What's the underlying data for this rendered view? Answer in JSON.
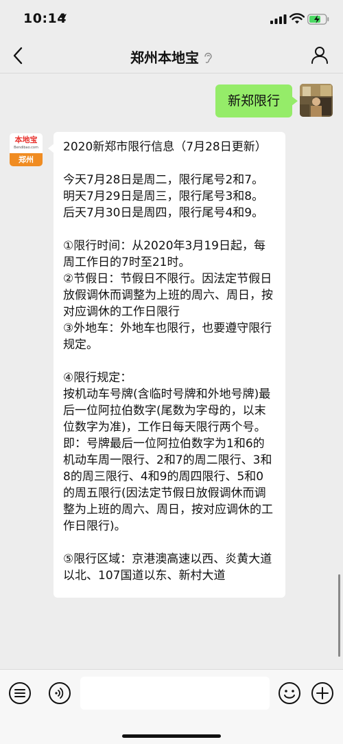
{
  "status_bar": {
    "time": "10:14"
  },
  "nav": {
    "title": "郑州本地宝"
  },
  "outgoing_message": {
    "text": "新郑限行"
  },
  "bot": {
    "logo_text": "本地宝",
    "logo_url": "Bendibao.com",
    "city_tag": "郑州"
  },
  "incoming_message": {
    "text": "2020新郑市限行信息（7月28日更新）\n\n今天7月28日是周二，限行尾号2和7。\n明天7月29日是周三，限行尾号3和8。\n后天7月30日是周四，限行尾号4和9。\n\n①限行时间：从2020年3月19日起，每周工作日的7时至21时。\n②节假日：节假日不限行。因法定节假日放假调休而调整为上班的周六、周日，按对应调休的工作日限行\n③外地车：外地车也限行，也要遵守限行规定。\n\n④限行规定：\n按机动车号牌(含临时号牌和外地号牌)最后一位阿拉伯数字(尾数为字母的，以末位数字为准)，工作日每天限行两个号。即：号牌最后一位阿拉伯数字为1和6的机动车周一限行、2和7的周二限行、3和8的周三限行、4和9的周四限行、5和0的周五限行(因法定节假日放假调休而调整为上班的周六、周日，按对应调休的工作日限行)。\n\n⑤限行区域：京港澳高速以西、炎黄大道以北、107国道以东、新村大道"
  },
  "colors": {
    "outgoing_bubble": "#95ec69",
    "background": "#ededed",
    "logo_red": "#e8322d",
    "logo_orange": "#f08c22"
  },
  "icons": [
    "location-arrow-icon",
    "signal-icon",
    "wifi-icon",
    "battery-charging-icon",
    "back-chevron-icon",
    "ear-icon",
    "profile-icon",
    "keyboard-menu-icon",
    "voice-icon",
    "emoji-icon",
    "plus-icon"
  ]
}
